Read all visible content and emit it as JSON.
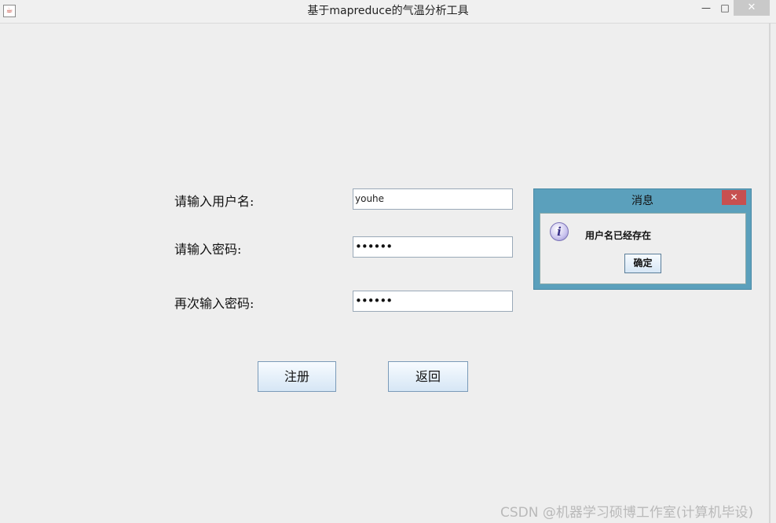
{
  "window": {
    "title": "基于mapreduce的气温分析工具",
    "icon": "java-app-icon",
    "controls": {
      "minimize": "—",
      "maximize": "□",
      "close": "✕"
    }
  },
  "form": {
    "username_label": "请输入用户名:",
    "username_value": "youhe",
    "password_label": "请输入密码:",
    "password_value": "••••••",
    "confirm_label": "再次输入密码:",
    "confirm_value": "••••••"
  },
  "buttons": {
    "register": "注册",
    "back": "返回"
  },
  "dialog": {
    "title": "消息",
    "close_glyph": "✕",
    "icon": "info-icon",
    "icon_glyph": "i",
    "message": "用户名已经存在",
    "ok": "确定"
  },
  "watermark": "CSDN @机器学习硕博工作室(计算机毕设)",
  "colors": {
    "dialog_frame": "#5ba0bc",
    "dialog_close": "#c75050",
    "button_border": "#7a9ab8"
  }
}
